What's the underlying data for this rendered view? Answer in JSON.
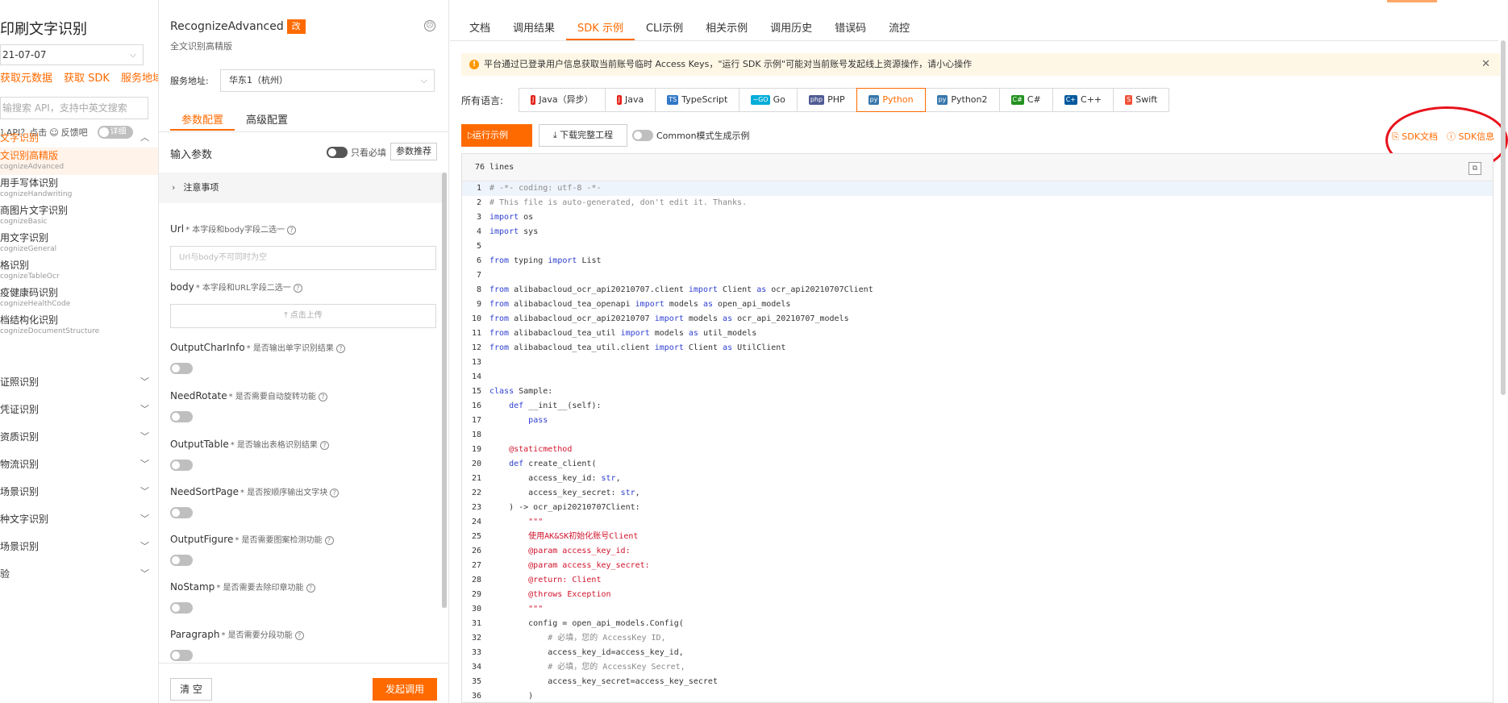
{
  "left": {
    "title": "印刷文字识别",
    "date": "21-07-07",
    "links": [
      "获取元数据",
      "获取 SDK",
      "服务地域"
    ],
    "search_placeholder": "输搜索 API，支持中英文搜索",
    "help_text": "] API？点击",
    "feedback": "反馈吧",
    "detail_toggle": "详细",
    "open_group": "文字识别",
    "items": [
      {
        "name": "文识别高精版",
        "sub": "cognizeAdvanced",
        "active": true
      },
      {
        "name": "用手写体识别",
        "sub": "cognizeHandwriting"
      },
      {
        "name": "商图片文字识别",
        "sub": "cognizeBasic"
      },
      {
        "name": "用文字识别",
        "sub": "cognizeGeneral"
      },
      {
        "name": "格识别",
        "sub": "cognizeTableOcr"
      },
      {
        "name": "疫健康码识别",
        "sub": "cognizeHealthCode"
      },
      {
        "name": "档结构化识别",
        "sub": "cognizeDocumentStructure"
      }
    ],
    "groups": [
      "证照识别",
      "凭证识别",
      "资质识别",
      "物流识别",
      "场景识别",
      "种文字识别",
      "场景识别",
      "验"
    ]
  },
  "middle": {
    "api_name": "RecognizeAdvanced",
    "badge": "改",
    "subtitle": "全文识别高精版",
    "server_label": "服务地址:",
    "server_value": "华东1（杭州）",
    "tabs": [
      "参数配置",
      "高级配置"
    ],
    "input_params": "输入参数",
    "only_required": "只看必填",
    "recommend_btn": "参数推荐",
    "notice": "注意事项",
    "params": [
      {
        "name": "Url",
        "hint": "* 本字段和body字段二选一",
        "kind": "input",
        "placeholder": "Url与body不可同时为空"
      },
      {
        "name": "body",
        "hint": "* 本字段和URL字段二选一",
        "kind": "upload",
        "placeholder": "点击上传"
      },
      {
        "name": "OutputCharInfo",
        "hint": "* 是否输出单字识别结果",
        "kind": "toggle"
      },
      {
        "name": "NeedRotate",
        "hint": "* 是否需要自动旋转功能",
        "kind": "toggle"
      },
      {
        "name": "OutputTable",
        "hint": "* 是否输出表格识别结果",
        "kind": "toggle"
      },
      {
        "name": "NeedSortPage",
        "hint": "* 是否按顺序输出文字块",
        "kind": "toggle"
      },
      {
        "name": "OutputFigure",
        "hint": "* 是否需要图案检测功能",
        "kind": "toggle"
      },
      {
        "name": "NoStamp",
        "hint": "* 是否需要去除印章功能",
        "kind": "toggle"
      },
      {
        "name": "Paragraph",
        "hint": "* 是否需要分段功能",
        "kind": "toggle"
      }
    ],
    "clear_btn": "清 空",
    "send_btn": "发起调用"
  },
  "right": {
    "tabs": [
      "文档",
      "调用结果",
      "SDK 示例",
      "CLI示例",
      "相关示例",
      "调用历史",
      "错误码",
      "流控"
    ],
    "active_tab": 2,
    "alert": "平台通过已登录用户信息获取当前账号临时 Access Keys，\"运行 SDK 示例\"可能对当前账号发起线上资源操作，请小心操作",
    "lang_label": "所有语言:",
    "languages": [
      {
        "label": "Java（异步）",
        "icon": "J",
        "color": "#e2231a"
      },
      {
        "label": "Java",
        "icon": "J",
        "color": "#e2231a"
      },
      {
        "label": "TypeScript",
        "icon": "TS",
        "color": "#3178c6"
      },
      {
        "label": "Go",
        "icon": "~GO",
        "color": "#00add8"
      },
      {
        "label": "PHP",
        "icon": "php",
        "color": "#4f5b93"
      },
      {
        "label": "Python",
        "icon": "py",
        "color": "#3776ab",
        "active": true
      },
      {
        "label": "Python2",
        "icon": "py",
        "color": "#3776ab"
      },
      {
        "label": "C#",
        "icon": "C#",
        "color": "#239120"
      },
      {
        "label": "C++",
        "icon": "C+",
        "color": "#00599c"
      },
      {
        "label": "Swift",
        "icon": "S",
        "color": "#f05138"
      }
    ],
    "run_btn": "运行示例",
    "download_btn": "下载完整工程",
    "common_toggle": "Common模式生成示例",
    "sdk_doc": "SDK文档",
    "sdk_info": "SDK信息",
    "lines_count": "76 lines",
    "code": [
      {
        "t": "# -*- coding: utf-8 -*-",
        "c": "comment"
      },
      {
        "t": "# This file is auto-generated, don't edit it. Thanks.",
        "c": "comment"
      },
      {
        "t": "import os",
        "c": "kw"
      },
      {
        "t": "import sys",
        "c": "kw"
      },
      {
        "t": "",
        "c": ""
      },
      {
        "t": "from typing import List",
        "c": "kw"
      },
      {
        "t": "",
        "c": ""
      },
      {
        "t": "from alibabacloud_ocr_api20210707.client import Client as ocr_api20210707Client",
        "c": "kw"
      },
      {
        "t": "from alibabacloud_tea_openapi import models as open_api_models",
        "c": "kw"
      },
      {
        "t": "from alibabacloud_ocr_api20210707 import models as ocr_api_20210707_models",
        "c": "kw"
      },
      {
        "t": "from alibabacloud_tea_util import models as util_models",
        "c": "kw"
      },
      {
        "t": "from alibabacloud_tea_util.client import Client as UtilClient",
        "c": "kw"
      },
      {
        "t": "",
        "c": ""
      },
      {
        "t": "",
        "c": ""
      },
      {
        "t": "class Sample:",
        "c": "kw"
      },
      {
        "t": "    def __init__(self):",
        "c": "kw"
      },
      {
        "t": "        pass",
        "c": "kw"
      },
      {
        "t": "",
        "c": ""
      },
      {
        "t": "    @staticmethod",
        "c": "dec"
      },
      {
        "t": "    def create_client(",
        "c": "kw"
      },
      {
        "t": "        access_key_id: str,",
        "c": "kw"
      },
      {
        "t": "        access_key_secret: str,",
        "c": "kw"
      },
      {
        "t": "    ) -> ocr_api20210707Client:",
        "c": ""
      },
      {
        "t": "        \"\"\"",
        "c": "str"
      },
      {
        "t": "        使用AK&SK初始化账号Client",
        "c": "str"
      },
      {
        "t": "        @param access_key_id:",
        "c": "str"
      },
      {
        "t": "        @param access_key_secret:",
        "c": "str"
      },
      {
        "t": "        @return: Client",
        "c": "str"
      },
      {
        "t": "        @throws Exception",
        "c": "str"
      },
      {
        "t": "        \"\"\"",
        "c": "str"
      },
      {
        "t": "        config = open_api_models.Config(",
        "c": ""
      },
      {
        "t": "            # 必填，您的 AccessKey ID,",
        "c": "comment"
      },
      {
        "t": "            access_key_id=access_key_id,",
        "c": ""
      },
      {
        "t": "            # 必填，您的 AccessKey Secret,",
        "c": "comment"
      },
      {
        "t": "            access_key_secret=access_key_secret",
        "c": ""
      },
      {
        "t": "        )",
        "c": ""
      }
    ],
    "colors": {
      "accent": "#ff6a00",
      "keyword": "#2e40d0",
      "comment": "#8a8a8a",
      "string": "#d0142c",
      "ring": "#e8121c"
    }
  }
}
